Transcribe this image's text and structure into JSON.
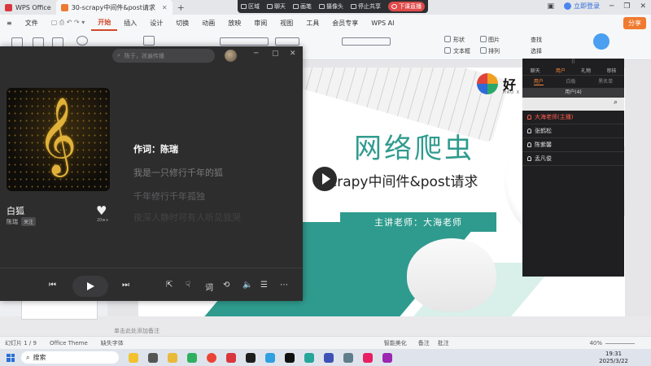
{
  "titlebar": {
    "tabs": [
      {
        "label": "WPS Office"
      },
      {
        "label": "30-scrapy中间件&post请求"
      }
    ],
    "login_label": "立即登录"
  },
  "livebar": {
    "items": [
      "区域",
      "聊天",
      "画笔",
      "摄像头",
      "停止共享",
      "下课直播"
    ]
  },
  "menubar": {
    "file_label": "文件",
    "items": [
      "开始",
      "插入",
      "设计",
      "切换",
      "动画",
      "放映",
      "审阅",
      "视图",
      "工具",
      "会员专享",
      "WPS AI"
    ],
    "share_label": "分享"
  },
  "ribbon": {
    "shape_label": "形状",
    "picture_label": "图片",
    "textbox_label": "文本框",
    "arrange_label": "排列",
    "find_label": "查找",
    "select_label": "选择"
  },
  "player": {
    "search_placeholder": "陈于，孩遍传播",
    "song_title": "白狐",
    "artist": "陈瑞",
    "follow_label": "关注",
    "likes": "20w+",
    "lyrics": [
      "作词：陈瑞",
      "我是一只修行千年的狐",
      "千年修行千年孤独",
      "夜深人静时可有人听见我哭"
    ],
    "controls": {
      "lyric_label": "词"
    }
  },
  "slide": {
    "brand_name": "好",
    "brand_sub": "HAO X",
    "title": "网络爬虫",
    "subtitle": "scrapy中间件&post请求",
    "teacher": "主讲老师：大海老师"
  },
  "chat": {
    "tabs": [
      "聊天",
      "用户",
      "礼物",
      "审核"
    ],
    "subtabs": [
      "用户",
      "白板",
      "黑名单"
    ],
    "user_count": "用户(4)",
    "users": [
      "大海老师(主播)",
      "张鹤松",
      "陈紫馨",
      "孟凡俊"
    ]
  },
  "statusbar": {
    "slide_index": "幻灯片 1 / 9",
    "theme": "Office Theme",
    "missing_font": "缺失字体",
    "beautify": "智能美化",
    "notes": "备注",
    "comments": "批注",
    "zoom": "40%",
    "notes_placeholder": "单击此处添加备注"
  },
  "taskbar": {
    "search_label": "搜索",
    "time": "19:31",
    "date": "2025/3/22"
  }
}
